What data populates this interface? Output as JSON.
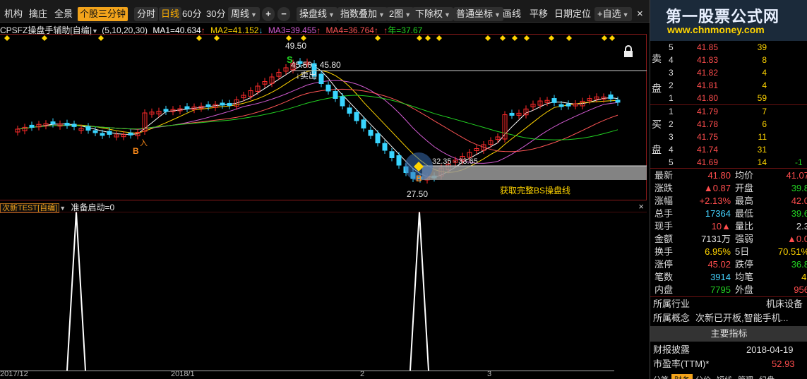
{
  "toolbar": {
    "items": [
      "机构",
      "擒庄",
      "全景"
    ],
    "period_label": "个股三分钟",
    "tabs": [
      "分时",
      "日线",
      "60分",
      "30分"
    ],
    "week_label": "周线",
    "zoom_in": "+",
    "zoom_out": "−",
    "dropdowns": [
      "操盘线",
      "指数叠加",
      "2图",
      "下除权",
      "普通坐标"
    ],
    "tools": [
      "画线",
      "平移",
      "日期定位",
      "+自选"
    ],
    "close": "×"
  },
  "ma_line": {
    "name": "CPSFZ操盘手辅助[自编]",
    "params": "(5,10,20,30)",
    "ma1": "MA1=40.634",
    "ma2": "MA2=41.152",
    "ma3": "MA3=39.455",
    "ma4": "MA4=36.764",
    "year": "年=37.67",
    "arrow_up": "↑",
    "arrow_down": "↓",
    "colors": {
      "ma1": "#ffffff",
      "ma2": "#ffd400",
      "ma3": "#d25bd2",
      "ma4": "#ff5555",
      "year": "#22d322"
    }
  },
  "main_chart": {
    "high_label": "49.50",
    "range_label": "45.50 - 45.80",
    "sell_label": "↓卖出",
    "sell_mark": "S",
    "low_label": "27.50",
    "buy_mark": "B",
    "buy_text": "入",
    "caption": "获取完整BS操盘线",
    "low_range_label": "32.35 - 33.65",
    "lock_icon": "lock"
  },
  "sub_chart": {
    "title": "次新TEST[自编]",
    "value": "准备启动=0",
    "close": "×"
  },
  "date_axis": [
    "2017/12",
    "2018/1",
    "2",
    "3"
  ],
  "brand": {
    "title": "第一股票公式网",
    "url": "www.chnmoney.com"
  },
  "order_book": {
    "sell_label": [
      "卖",
      "盘"
    ],
    "buy_label": [
      "买",
      "盘"
    ],
    "asks": [
      {
        "level": "5",
        "price": "41.85",
        "volume": "39"
      },
      {
        "level": "4",
        "price": "41.83",
        "volume": "8"
      },
      {
        "level": "3",
        "price": "41.82",
        "volume": "4"
      },
      {
        "level": "2",
        "price": "41.81",
        "volume": "4"
      },
      {
        "level": "1",
        "price": "41.80",
        "volume": "59"
      }
    ],
    "bids": [
      {
        "level": "1",
        "price": "41.79",
        "volume": "7"
      },
      {
        "level": "2",
        "price": "41.78",
        "volume": "6"
      },
      {
        "level": "3",
        "price": "41.75",
        "volume": "11"
      },
      {
        "level": "4",
        "price": "41.74",
        "volume": "31"
      },
      {
        "level": "5",
        "price": "41.69",
        "volume": "14"
      }
    ],
    "bid_extra": [
      "",
      "",
      "",
      "",
      "-1"
    ]
  },
  "quote": [
    {
      "k1": "最新",
      "v1": "41.80",
      "c1": "red",
      "k2": "均价",
      "v2": "41.07",
      "c2": "red"
    },
    {
      "k1": "涨跌",
      "v1": "▲0.87",
      "c1": "red",
      "k2": "开盘",
      "v2": "39.8",
      "c2": "green"
    },
    {
      "k1": "涨幅",
      "v1": "+2.13%",
      "c1": "red",
      "k2": "最高",
      "v2": "42.0",
      "c2": "red"
    },
    {
      "k1": "总手",
      "v1": "17364",
      "c1": "cyan",
      "k2": "最低",
      "v2": "39.6",
      "c2": "green"
    },
    {
      "k1": "现手",
      "v1": "10▲",
      "c1": "red",
      "k2": "量比",
      "v2": "2.3",
      "c2": "white"
    },
    {
      "k1": "金额",
      "v1": "7131万",
      "c1": "white",
      "k2": "强弱",
      "v2": "▲0.0",
      "c2": "red"
    },
    {
      "k1": "换手",
      "v1": "6.95%",
      "c1": "yellow",
      "k2": "5日",
      "v2": "70.51%",
      "c2": "yellow"
    },
    {
      "k1": "涨停",
      "v1": "45.02",
      "c1": "red",
      "k2": "跌停",
      "v2": "36.8",
      "c2": "green"
    },
    {
      "k1": "笔数",
      "v1": "3914",
      "c1": "cyan",
      "k2": "均笔",
      "v2": "4.",
      "c2": "yellow"
    },
    {
      "k1": "内盘",
      "v1": "7795",
      "c1": "green",
      "k2": "外盘",
      "v2": "956",
      "c2": "red"
    }
  ],
  "industry": {
    "label": "所属行业",
    "value": "机床设备"
  },
  "concept": {
    "label": "所属概念",
    "value": "次新已开板,智能手机..."
  },
  "main_indicator": "主要指标",
  "financial": {
    "label": "财报披露",
    "value": "2018-04-19"
  },
  "pe": {
    "label": "市盈率(TTM)*",
    "value": "52.93"
  },
  "bottom_tabs": [
    "分笔",
    "财务",
    "分价",
    "短线",
    "管理",
    "纪盘"
  ]
}
